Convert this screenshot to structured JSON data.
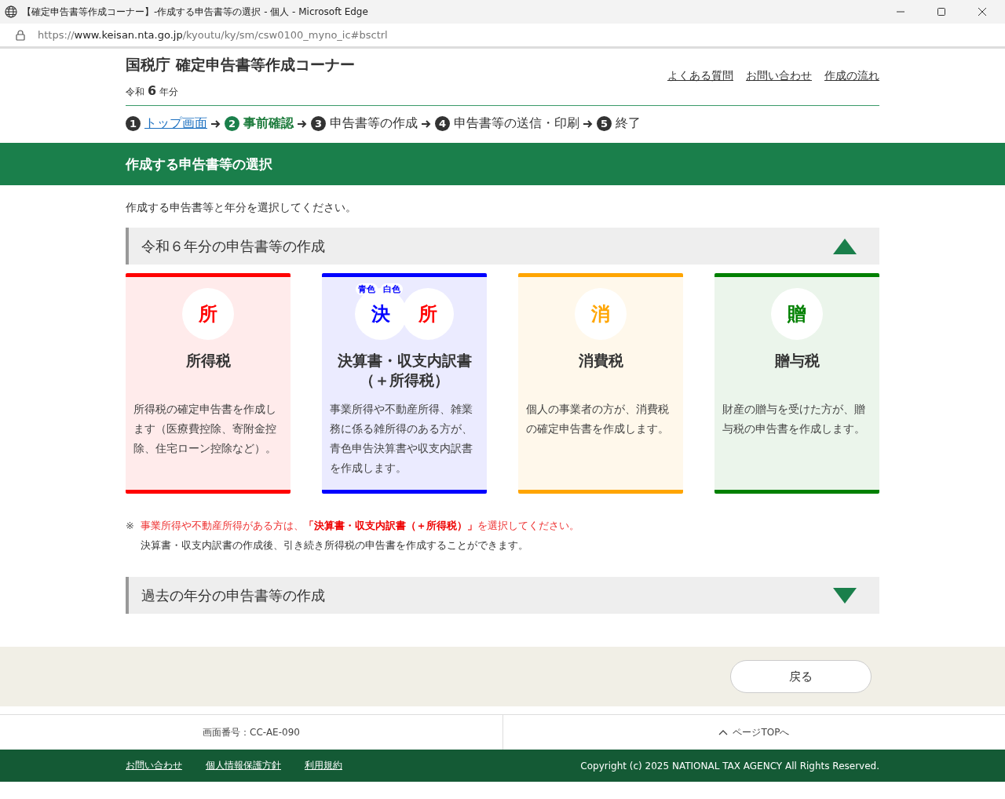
{
  "browser": {
    "title": "【確定申告書等作成コーナー】-作成する申告書等の選択 - 個人 - Microsoft Edge",
    "url_scheme": "https://",
    "url_host": "www.keisan.nta.go.jp",
    "url_path": "/kyoutu/ky/sm/csw0100_myno_ic#bsctrl"
  },
  "header": {
    "title": "国税庁 確定申告書等作成コーナー",
    "era": "令和",
    "year": "6",
    "year_suffix": "年分",
    "links": [
      "よくある質問",
      "お問い合わせ",
      "作成の流れ"
    ]
  },
  "steps": [
    {
      "number": "1",
      "label": "トップ画面",
      "kind": "link"
    },
    {
      "number": "2",
      "label": "事前確認",
      "kind": "current"
    },
    {
      "number": "3",
      "label": "申告書等の作成",
      "kind": "plain"
    },
    {
      "number": "4",
      "label": "申告書等の送信・印刷",
      "kind": "plain"
    },
    {
      "number": "5",
      "label": "終了",
      "kind": "plain"
    }
  ],
  "page_title": "作成する申告書等の選択",
  "instruction": "作成する申告書等と年分を選択してください。",
  "sections": [
    {
      "title": "令和６年分の申告書等の作成",
      "expanded": true,
      "cards": [
        {
          "color": "#ff0000",
          "icons": [
            {
              "char": "所",
              "color": "#ff0000"
            }
          ],
          "title": "所得税",
          "description": "所得税の確定申告書を作成します（医療費控除、寄附金控除、住宅ローン控除など）。"
        },
        {
          "color": "#0000ff",
          "tags": [
            "青色",
            "白色"
          ],
          "icons": [
            {
              "char": "決",
              "color": "#0000ff"
            },
            {
              "char": "所",
              "color": "#ff0000"
            }
          ],
          "title": "決算書・収支内訳書（＋所得税）",
          "description": "事業所得や不動産所得、雑業務に係る雑所得のある方が、青色申告決算書や収支内訳書を作成します。"
        },
        {
          "color": "#ffa500",
          "icons": [
            {
              "char": "消",
              "color": "#ffa500"
            }
          ],
          "title": "消費税",
          "description": "個人の事業者の方が、消費税の確定申告書を作成します。"
        },
        {
          "color": "#008000",
          "icons": [
            {
              "char": "贈",
              "color": "#008000"
            }
          ],
          "title": "贈与税",
          "description": "財産の贈与を受けた方が、贈与税の申告書を作成します。"
        }
      ],
      "note_mark": "※",
      "note_lines": [
        "事業所得や不動産所得がある方は、**「決算書・収支内訳書（＋所得税）」**を選択してください。",
        "決算書・収支内訳書の作成後、引き続き所得税の申告書を作成することができます。"
      ]
    },
    {
      "title": "過去の年分の申告書等の作成",
      "expanded": false
    }
  ],
  "back_button": "戻る",
  "screen_id": "画面番号：CC-AE-090",
  "page_top": "ページTOPへ",
  "footer": {
    "links": [
      "お問い合わせ",
      "個人情報保護方針",
      "利用規約"
    ],
    "copyright": "Copyright (c) 2025 NATIONAL TAX AGENCY All Rights Reserved."
  }
}
